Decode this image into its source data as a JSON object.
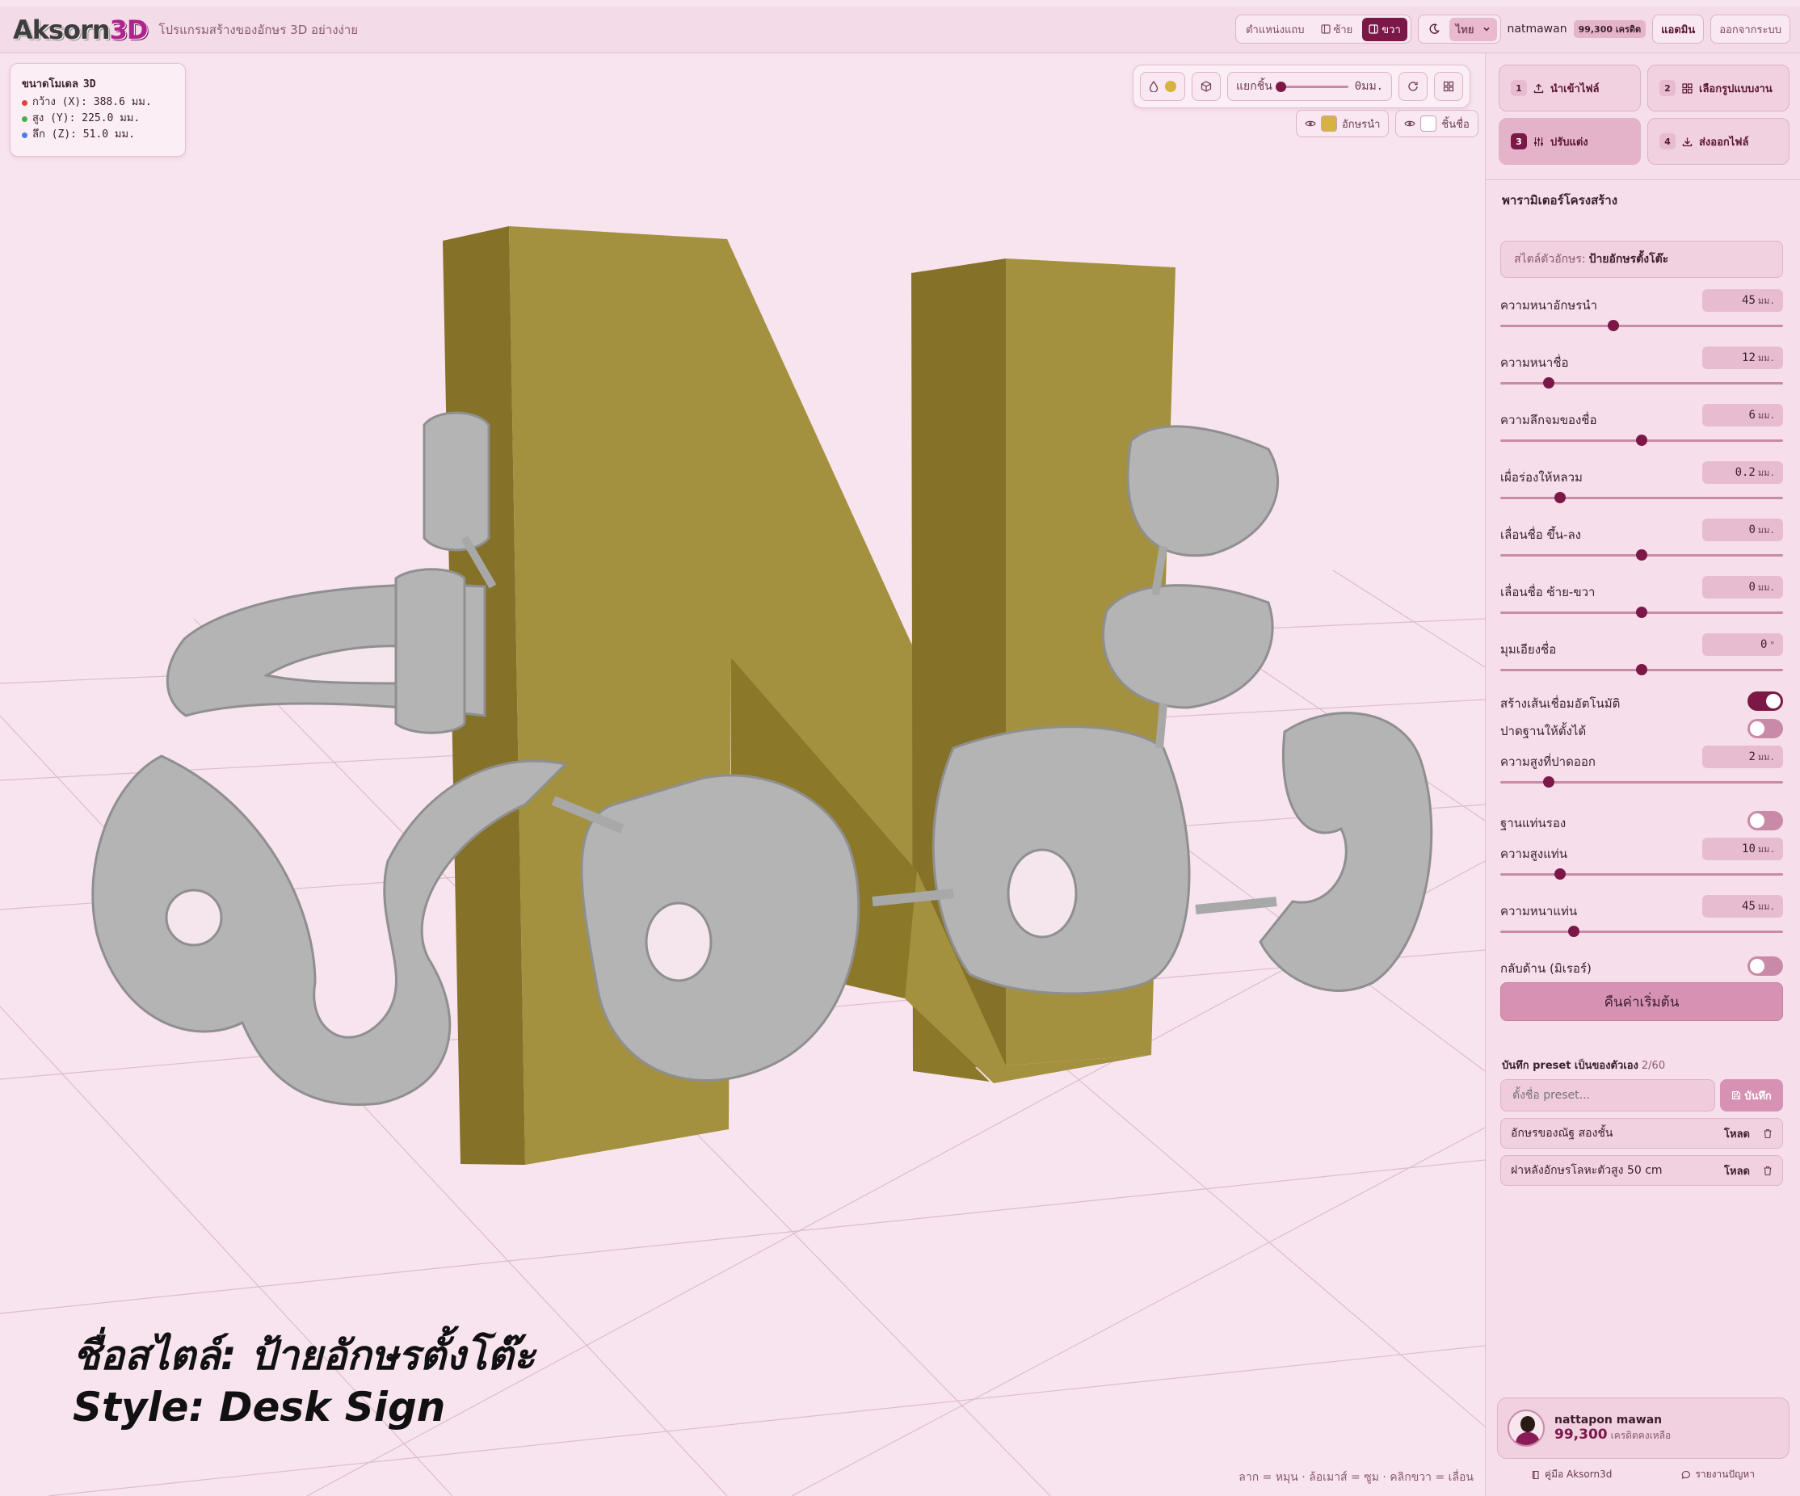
{
  "topbar": {
    "logo_main": "Aksorn",
    "logo_accent": "3D",
    "tagline": "โปรแกรมสร้างของอักษร 3D อย่างง่าย",
    "layout_label": "ตำแหน่งแถบ",
    "layout_left": "ซ้าย",
    "layout_right": "ขวา",
    "language": "ไทย",
    "username": "natmawan",
    "credits": "99,300 เครดิต",
    "admin_button": "แอดมิน",
    "logout_button": "ออกจากระบบ"
  },
  "viewport": {
    "dims_title": "ขนาดโมเดล",
    "dims_title_accent": "3D",
    "dim_x": "กว้าง (X): 388.6 มม.",
    "dim_y": "สูง (Y): 225.0 มม.",
    "dim_z": "ลึก (Z): 51.0 มม.",
    "dim_colors": {
      "x": "#e0443a",
      "y": "#47b04b",
      "z": "#4a7ee6"
    },
    "explode_label": "แยกชิ้น",
    "explode_value": "0มม.",
    "explode_level": 0,
    "toggle_lead": "อักษรนำ",
    "toggle_name": "ชิ้นชื่อ",
    "lead_color": "#d6b33f",
    "name_color": "#ffffff",
    "lead_letter": "N",
    "name_text": "ชื่อตั้ง",
    "caption_line1": "ชื่อสไตล์: ป้ายอักษรตั้งโต๊ะ",
    "caption_line2": "Style: Desk Sign",
    "hint": "ลาก = หมุน · ล้อเมาส์ = ซูม · คลิกขวา = เลื่อน"
  },
  "steps": [
    {
      "num": "1",
      "label": "นำเข้าไฟล์"
    },
    {
      "num": "2",
      "label": "เลือกรูปแบบงาน"
    },
    {
      "num": "3",
      "label": "ปรับแต่ง"
    },
    {
      "num": "4",
      "label": "ส่งออกไฟล์"
    }
  ],
  "panel": {
    "title": "พารามิเตอร์โครงสร้าง",
    "style_prefix": "สไตล์ตัวอักษร:",
    "style_value": "ป้ายอักษรตั้งโต๊ะ",
    "params_a": [
      {
        "label": "ความหนาอักษรนำ",
        "value": "45",
        "unit": "มม.",
        "pos": 0.4
      },
      {
        "label": "ความหนาชื่อ",
        "value": "12",
        "unit": "มม.",
        "pos": 0.17
      },
      {
        "label": "ความลึกจมของชื่อ",
        "value": "6",
        "unit": "มม.",
        "pos": 0.5
      },
      {
        "label": "เผื่อร่องให้หลวม",
        "value": "0.2",
        "unit": "มม.",
        "pos": 0.21
      },
      {
        "label": "เลื่อนชื่อ ขึ้น-ลง",
        "value": "0",
        "unit": "มม.",
        "pos": 0.5
      },
      {
        "label": "เลื่อนชื่อ ซ้าย-ขวา",
        "value": "0",
        "unit": "มม.",
        "pos": 0.5
      },
      {
        "label": "มุมเอียงชื่อ",
        "value": "0",
        "unit": "°",
        "pos": 0.5
      }
    ],
    "toggle_connect": "สร้างเส้นเชื่อมอัตโนมัติ",
    "toggle_flatten": "ปาดฐานให้ตั้งได้",
    "param_cut": {
      "label": "ความสูงที่ปาดออก",
      "value": "2",
      "unit": "มม.",
      "pos": 0.17
    },
    "toggle_base": "ฐานแท่นรอง",
    "param_base_h": {
      "label": "ความสูงแท่น",
      "value": "10",
      "unit": "มม.",
      "pos": 0.21
    },
    "param_base_t": {
      "label": "ความหนาแท่น",
      "value": "45",
      "unit": "มม.",
      "pos": 0.26
    },
    "toggle_mirror": "กลับด้าน (มิเรอร์)",
    "reset_button": "คืนค่าเริ่มต้น",
    "preset_title": "บันทึก preset เป็นของตัวเอง",
    "preset_count": "2/60",
    "preset_placeholder": "ตั้งชื่อ preset...",
    "preset_save": "บันทึก",
    "presets": [
      {
        "name": "อักษรของณัฐ สองชั้น",
        "load": "โหลด"
      },
      {
        "name": "ฝาหลังอักษรโลหะตัวสูง 50 cm",
        "load": "โหลด"
      }
    ]
  },
  "user_card": {
    "name": "nattapon mawan",
    "credits": "99,300",
    "credits_label": "เครดิตคงเหลือ"
  },
  "footer": {
    "manual": "คู่มือ Aksorn3d",
    "report": "รายงานปัญหา"
  }
}
